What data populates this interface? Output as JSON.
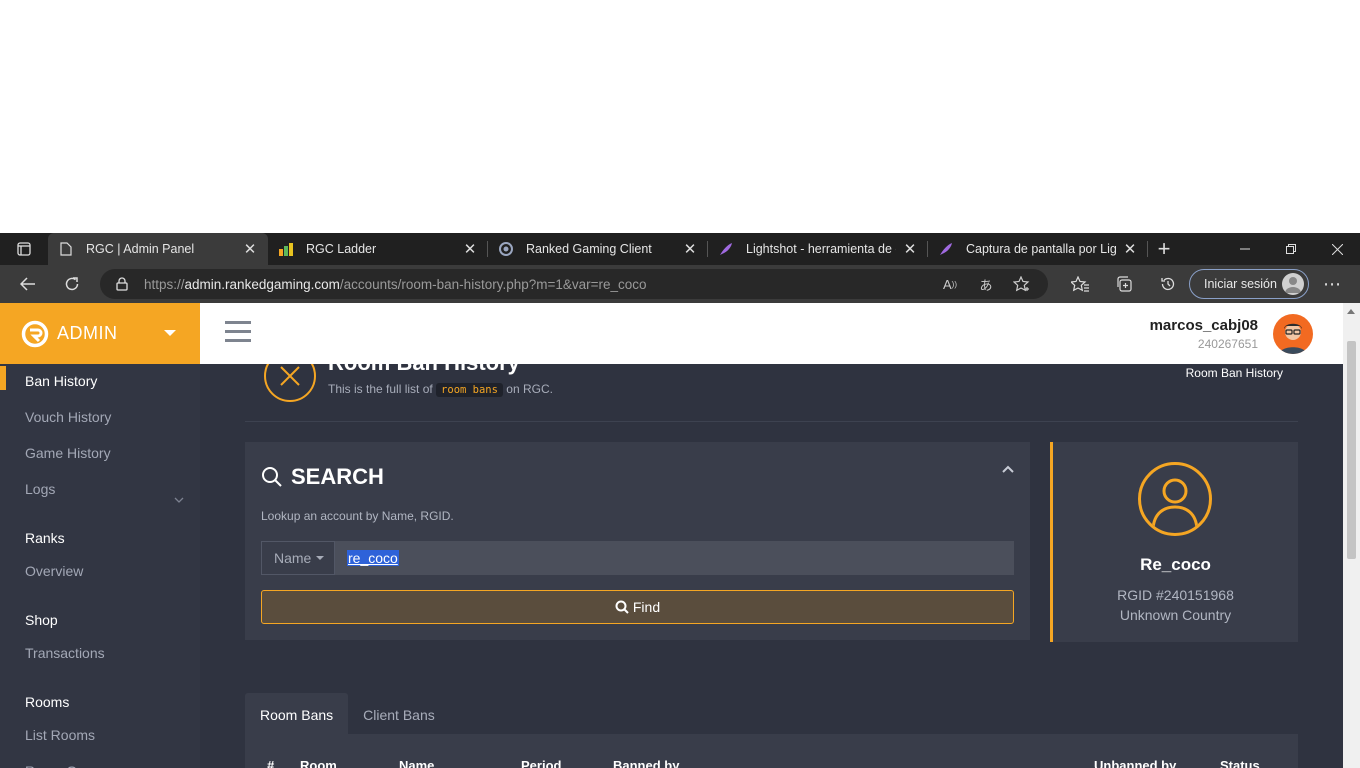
{
  "browser": {
    "tabs": [
      {
        "title": "RGC | Admin Panel",
        "icon": "page-icon",
        "active": true
      },
      {
        "title": "RGC Ladder",
        "icon": "bar-chart-favicon"
      },
      {
        "title": "Ranked Gaming Client",
        "icon": "rgc-favicon"
      },
      {
        "title": "Lightshot - herramienta de ca",
        "icon": "feather-favicon"
      },
      {
        "title": "Captura de pantalla por Light",
        "icon": "feather-favicon"
      }
    ],
    "url_scheme": "https://",
    "url_host": "admin.rankedgaming.com",
    "url_path": "/accounts/room-ban-history.php?m=1&var=re_coco",
    "signin_label": "Iniciar sesión"
  },
  "sidebar": {
    "brand": "ADMIN",
    "items": [
      {
        "label": "Ban History",
        "type": "item",
        "active": true
      },
      {
        "label": "Vouch History",
        "type": "item"
      },
      {
        "label": "Game History",
        "type": "item"
      },
      {
        "label": "Logs",
        "type": "item",
        "expandable": true
      },
      {
        "label": "Ranks",
        "type": "header"
      },
      {
        "label": "Overview",
        "type": "item"
      },
      {
        "label": "Shop",
        "type": "header"
      },
      {
        "label": "Transactions",
        "type": "item"
      },
      {
        "label": "Rooms",
        "type": "header"
      },
      {
        "label": "List Rooms",
        "type": "item"
      },
      {
        "label": "Room Games",
        "type": "item"
      }
    ]
  },
  "topbar": {
    "username": "marcos_cabj08",
    "user_id": "240267651"
  },
  "page_header": {
    "title": "Room Ban History",
    "subtitle_before": "This is the full list of ",
    "subtitle_code": "room bans",
    "subtitle_after": " on RGC.",
    "breadcrumb": "Room Ban History"
  },
  "search": {
    "title": "SEARCH",
    "description": "Lookup an account by Name, RGID.",
    "dropdown_value": "Name",
    "input_value": "re_coco",
    "find_label": "Find"
  },
  "profile": {
    "name": "Re_coco",
    "rgid": "RGID #240151968",
    "country": "Unknown Country"
  },
  "bans_tabs": [
    "Room Bans",
    "Client Bans"
  ],
  "table": {
    "columns": [
      "#",
      "Room",
      "Name",
      "Period",
      "Banned by",
      "Unbanned by",
      "Status"
    ]
  },
  "colors": {
    "accent": "#f5a623",
    "page_bg": "#2f3340",
    "card_bg": "#393d4a",
    "sidebar_bg": "#323643"
  }
}
